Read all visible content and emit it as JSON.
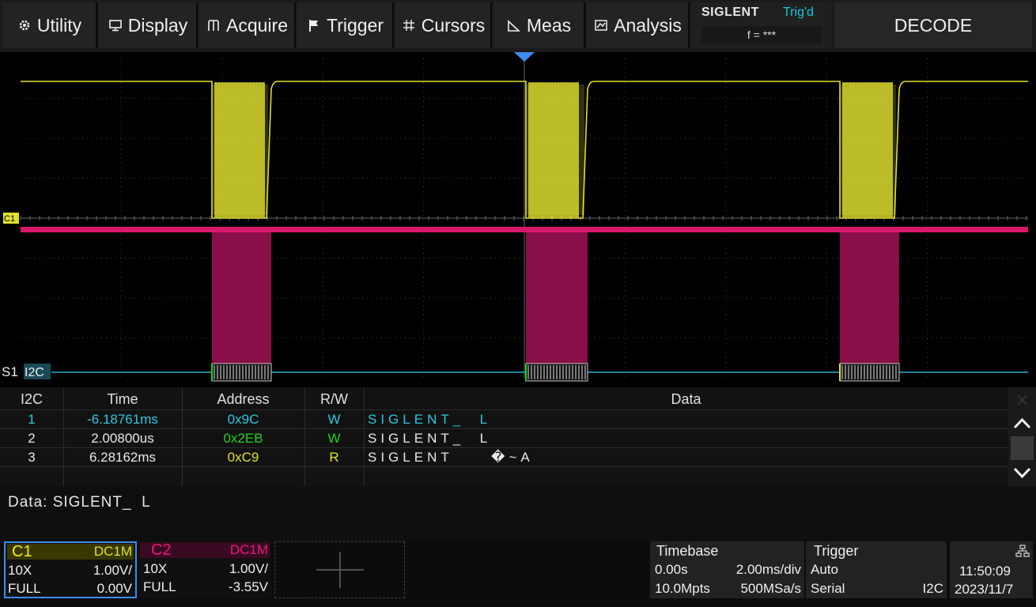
{
  "menu": {
    "utility": "Utility",
    "display": "Display",
    "acquire": "Acquire",
    "trigger": "Trigger",
    "cursors": "Cursors",
    "meas": "Meas",
    "analysis": "Analysis"
  },
  "brand": {
    "name": "SIGLENT",
    "trig_status": "Trig'd",
    "frequency": "f = ***"
  },
  "decode_title": "DECODE",
  "scope": {
    "ch1_marker": "C1",
    "bus_label_prefix": "S1",
    "bus_label": "I2C",
    "colors": {
      "ch1": "#e0e030",
      "ch2": "#d8186a",
      "bus": "#2ab0c8",
      "ch2_fill": "#8a0e48"
    },
    "packets": [
      {
        "name": "packet-1"
      },
      {
        "name": "packet-2"
      },
      {
        "name": "packet-3"
      }
    ]
  },
  "decode_table": {
    "headers": {
      "index": "I2C",
      "time": "Time",
      "address": "Address",
      "rw": "R/W",
      "data": "Data"
    },
    "rows": [
      {
        "index": "1",
        "time": "-6.18761ms",
        "address": "0x9C",
        "rw": "W",
        "data": "SIGLENT_  L",
        "selected": true
      },
      {
        "index": "2",
        "time": "2.00800us",
        "address": "0x2EB",
        "rw": "W",
        "data": "SIGLENT_  L",
        "selected": false
      },
      {
        "index": "3",
        "time": "6.28162ms",
        "address": "0xC9",
        "rw": "R",
        "data": "SIGLENT     �~A",
        "selected": false
      }
    ]
  },
  "detail": {
    "text": "Data: SIGLENT_  L"
  },
  "channels": {
    "c1": {
      "name": "C1",
      "coupling": "DC1M",
      "probe": "10X",
      "scale": "1.00V/",
      "bandwidth": "FULL",
      "offset": "0.00V"
    },
    "c2": {
      "name": "C2",
      "coupling": "DC1M",
      "probe": "10X",
      "scale": "1.00V/",
      "bandwidth": "FULL",
      "offset": "-3.55V"
    }
  },
  "timebase": {
    "title": "Timebase",
    "delay": "0.00s",
    "scale": "2.00ms/div",
    "memory": "10.0Mpts",
    "sample_rate": "500MSa/s"
  },
  "trigger": {
    "title": "Trigger",
    "mode": "Auto",
    "type": "Serial",
    "source": "I2C"
  },
  "clock": {
    "time": "11:50:09",
    "date": "2023/11/7"
  }
}
